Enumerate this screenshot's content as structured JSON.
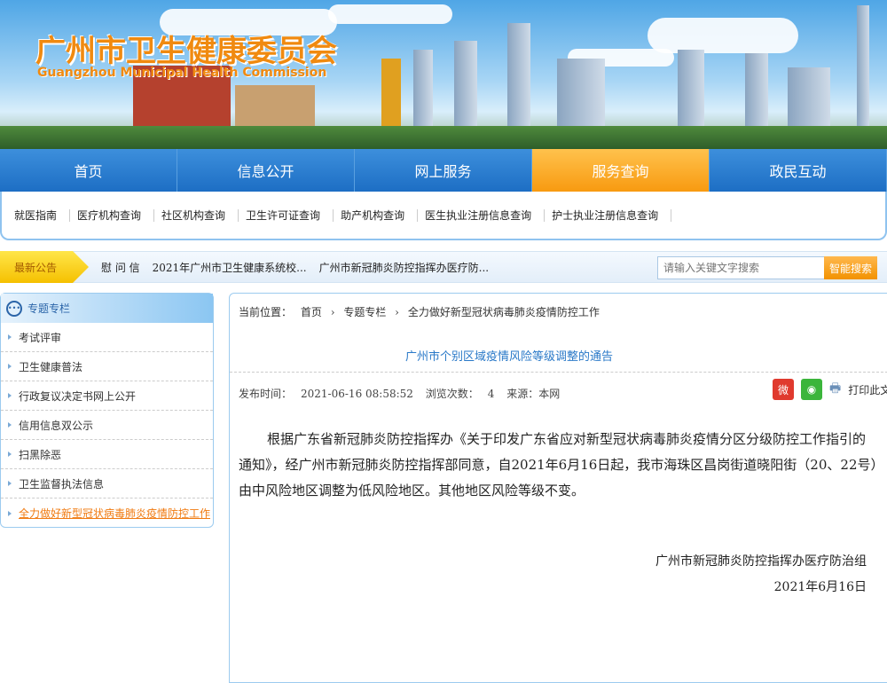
{
  "header": {
    "title_cn": "广州市卫生健康委员会",
    "title_en": "Guangzhou Municipal Health Commission"
  },
  "nav": [
    "首页",
    "信息公开",
    "网上服务",
    "服务查询",
    "政民互动"
  ],
  "nav_active": 3,
  "subnav": [
    "就医指南",
    "医疗机构查询",
    "社区机构查询",
    "卫生许可证查询",
    "助产机构查询",
    "医生执业注册信息查询",
    "护士执业注册信息查询"
  ],
  "notice": {
    "label": "最新公告",
    "links": [
      "慰 问 信",
      "2021年广州市卫生健康系统校...",
      "广州市新冠肺炎防控指挥办医疗防..."
    ]
  },
  "search": {
    "placeholder": "请输入关键文字搜索",
    "button": "智能搜索"
  },
  "sidebar": {
    "title": "专题专栏",
    "items": [
      "考试评审",
      "卫生健康普法",
      "行政复议决定书网上公开",
      "信用信息双公示",
      "扫黑除恶",
      "卫生监督执法信息",
      "全力做好新型冠状病毒肺炎疫情防控工作"
    ]
  },
  "breadcrumb": {
    "label": "当前位置：",
    "items": [
      "首页",
      "›",
      "专题专栏",
      "›",
      "全力做好新型冠状病毒肺炎疫情防控工作"
    ]
  },
  "article": {
    "title": "广州市个别区域疫情风险等级调整的通告",
    "publish_label": "发布时间：",
    "publish_time": "2021-06-16 08:58:52",
    "views_label": "浏览次数：",
    "views": "4",
    "source": "来源：本网",
    "print": "打印此文",
    "body": "根据广东省新冠肺炎防控指挥办《关于印发广东省应对新型冠状病毒肺炎疫情分区分级防控工作指引的通知》，经广州市新冠肺炎防控指挥部同意，自2021年6月16日起，我市海珠区昌岗街道晓阳街（20、22号）由中风险地区调整为低风险地区。其他地区风险等级不变。",
    "signer": "广州市新冠肺炎防控指挥办医疗防治组",
    "date": "2021年6月16日"
  },
  "colors": {
    "nav_blue": "#1d6ec4",
    "active_orange": "#f89a10",
    "title_blue": "#2a79c8"
  }
}
